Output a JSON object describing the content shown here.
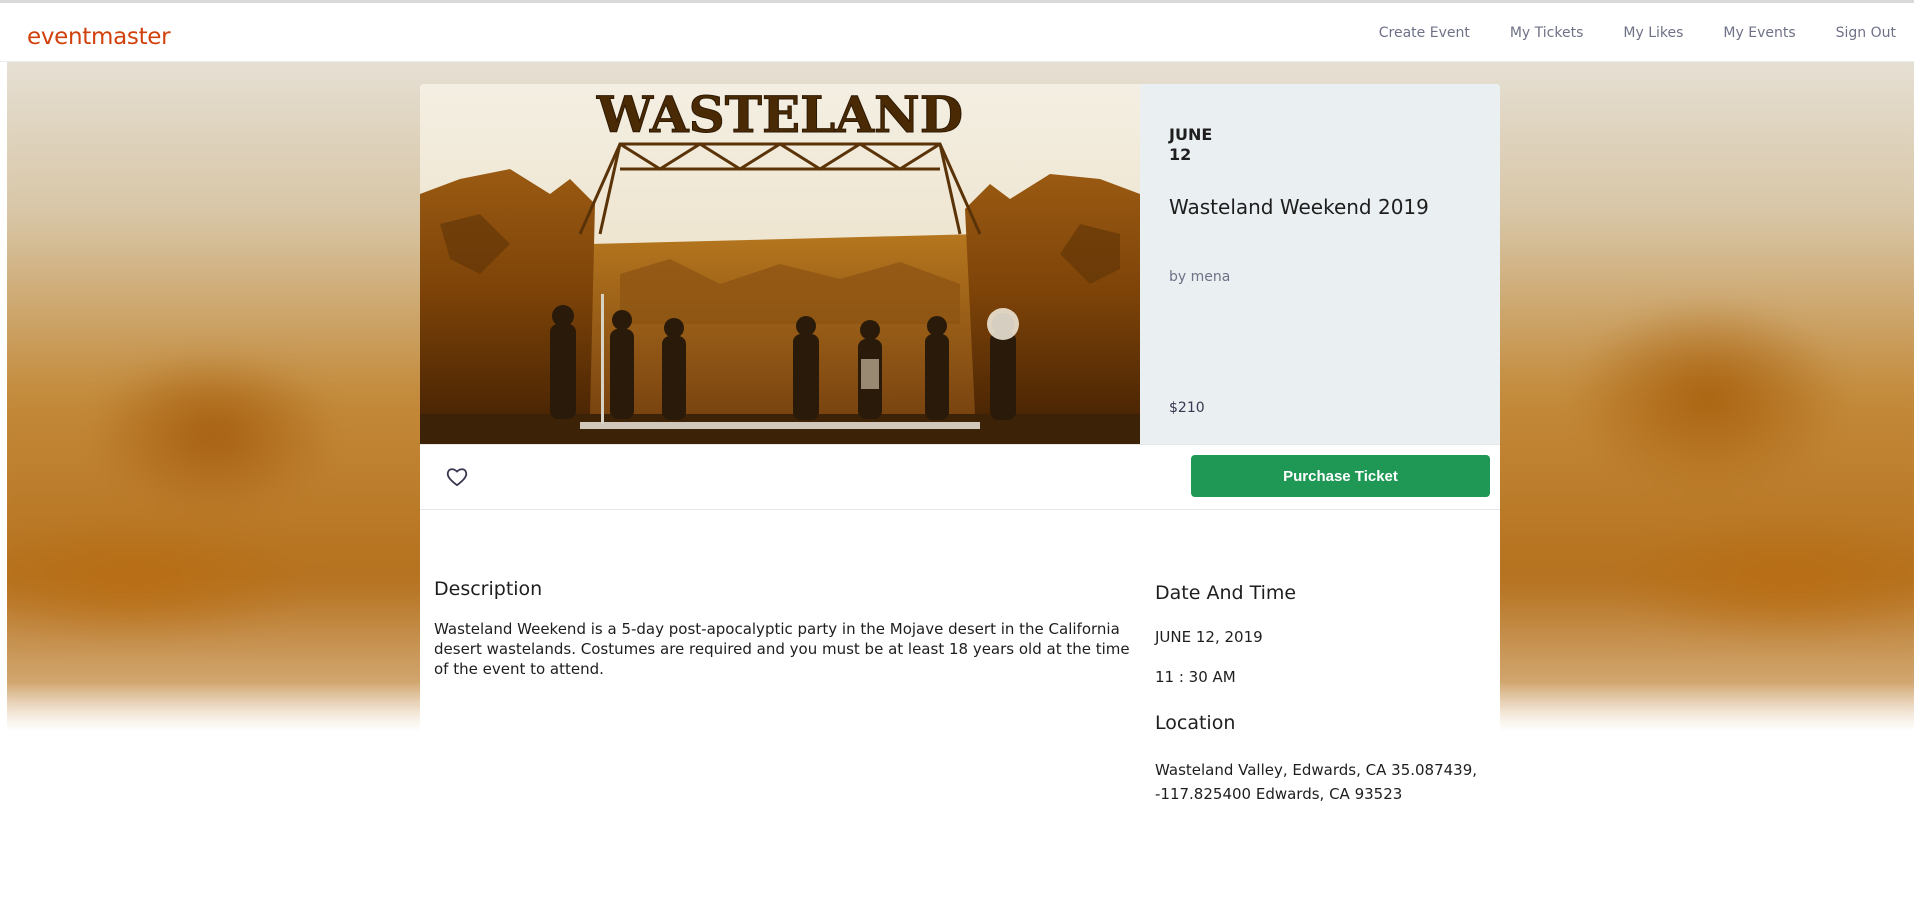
{
  "app": {
    "logo": "eventmaster"
  },
  "nav": {
    "links": [
      "Create Event",
      "My Tickets",
      "My Likes",
      "My Events",
      "Sign Out"
    ]
  },
  "event": {
    "month": "JUNE",
    "day": "12",
    "title": "Wasteland Weekend 2019",
    "organizer": "by mena",
    "price": "$210",
    "image_sign": "WASTELAND",
    "like_icon": "heart-outline-icon",
    "purchase_label": "Purchase Ticket",
    "description_heading": "Description",
    "description": "Wasteland Weekend is a 5-day post-apocalyptic party in the Mojave desert in the California desert wastelands. Costumes are required and you must be at least 18 years old at the time of the event to attend.",
    "datetime_heading": "Date And Time",
    "date_full": "JUNE 12, 2019",
    "time": "11 : 30 AM",
    "location_heading": "Location",
    "location": "Wasteland Valley, Edwards, CA 35.087439, -117.825400 Edwards, CA 93523"
  },
  "colors": {
    "brand": "#d1410c",
    "purchase_button": "#1e9854",
    "side_panel": "#eaeff2",
    "muted_text": "#6f7287"
  }
}
